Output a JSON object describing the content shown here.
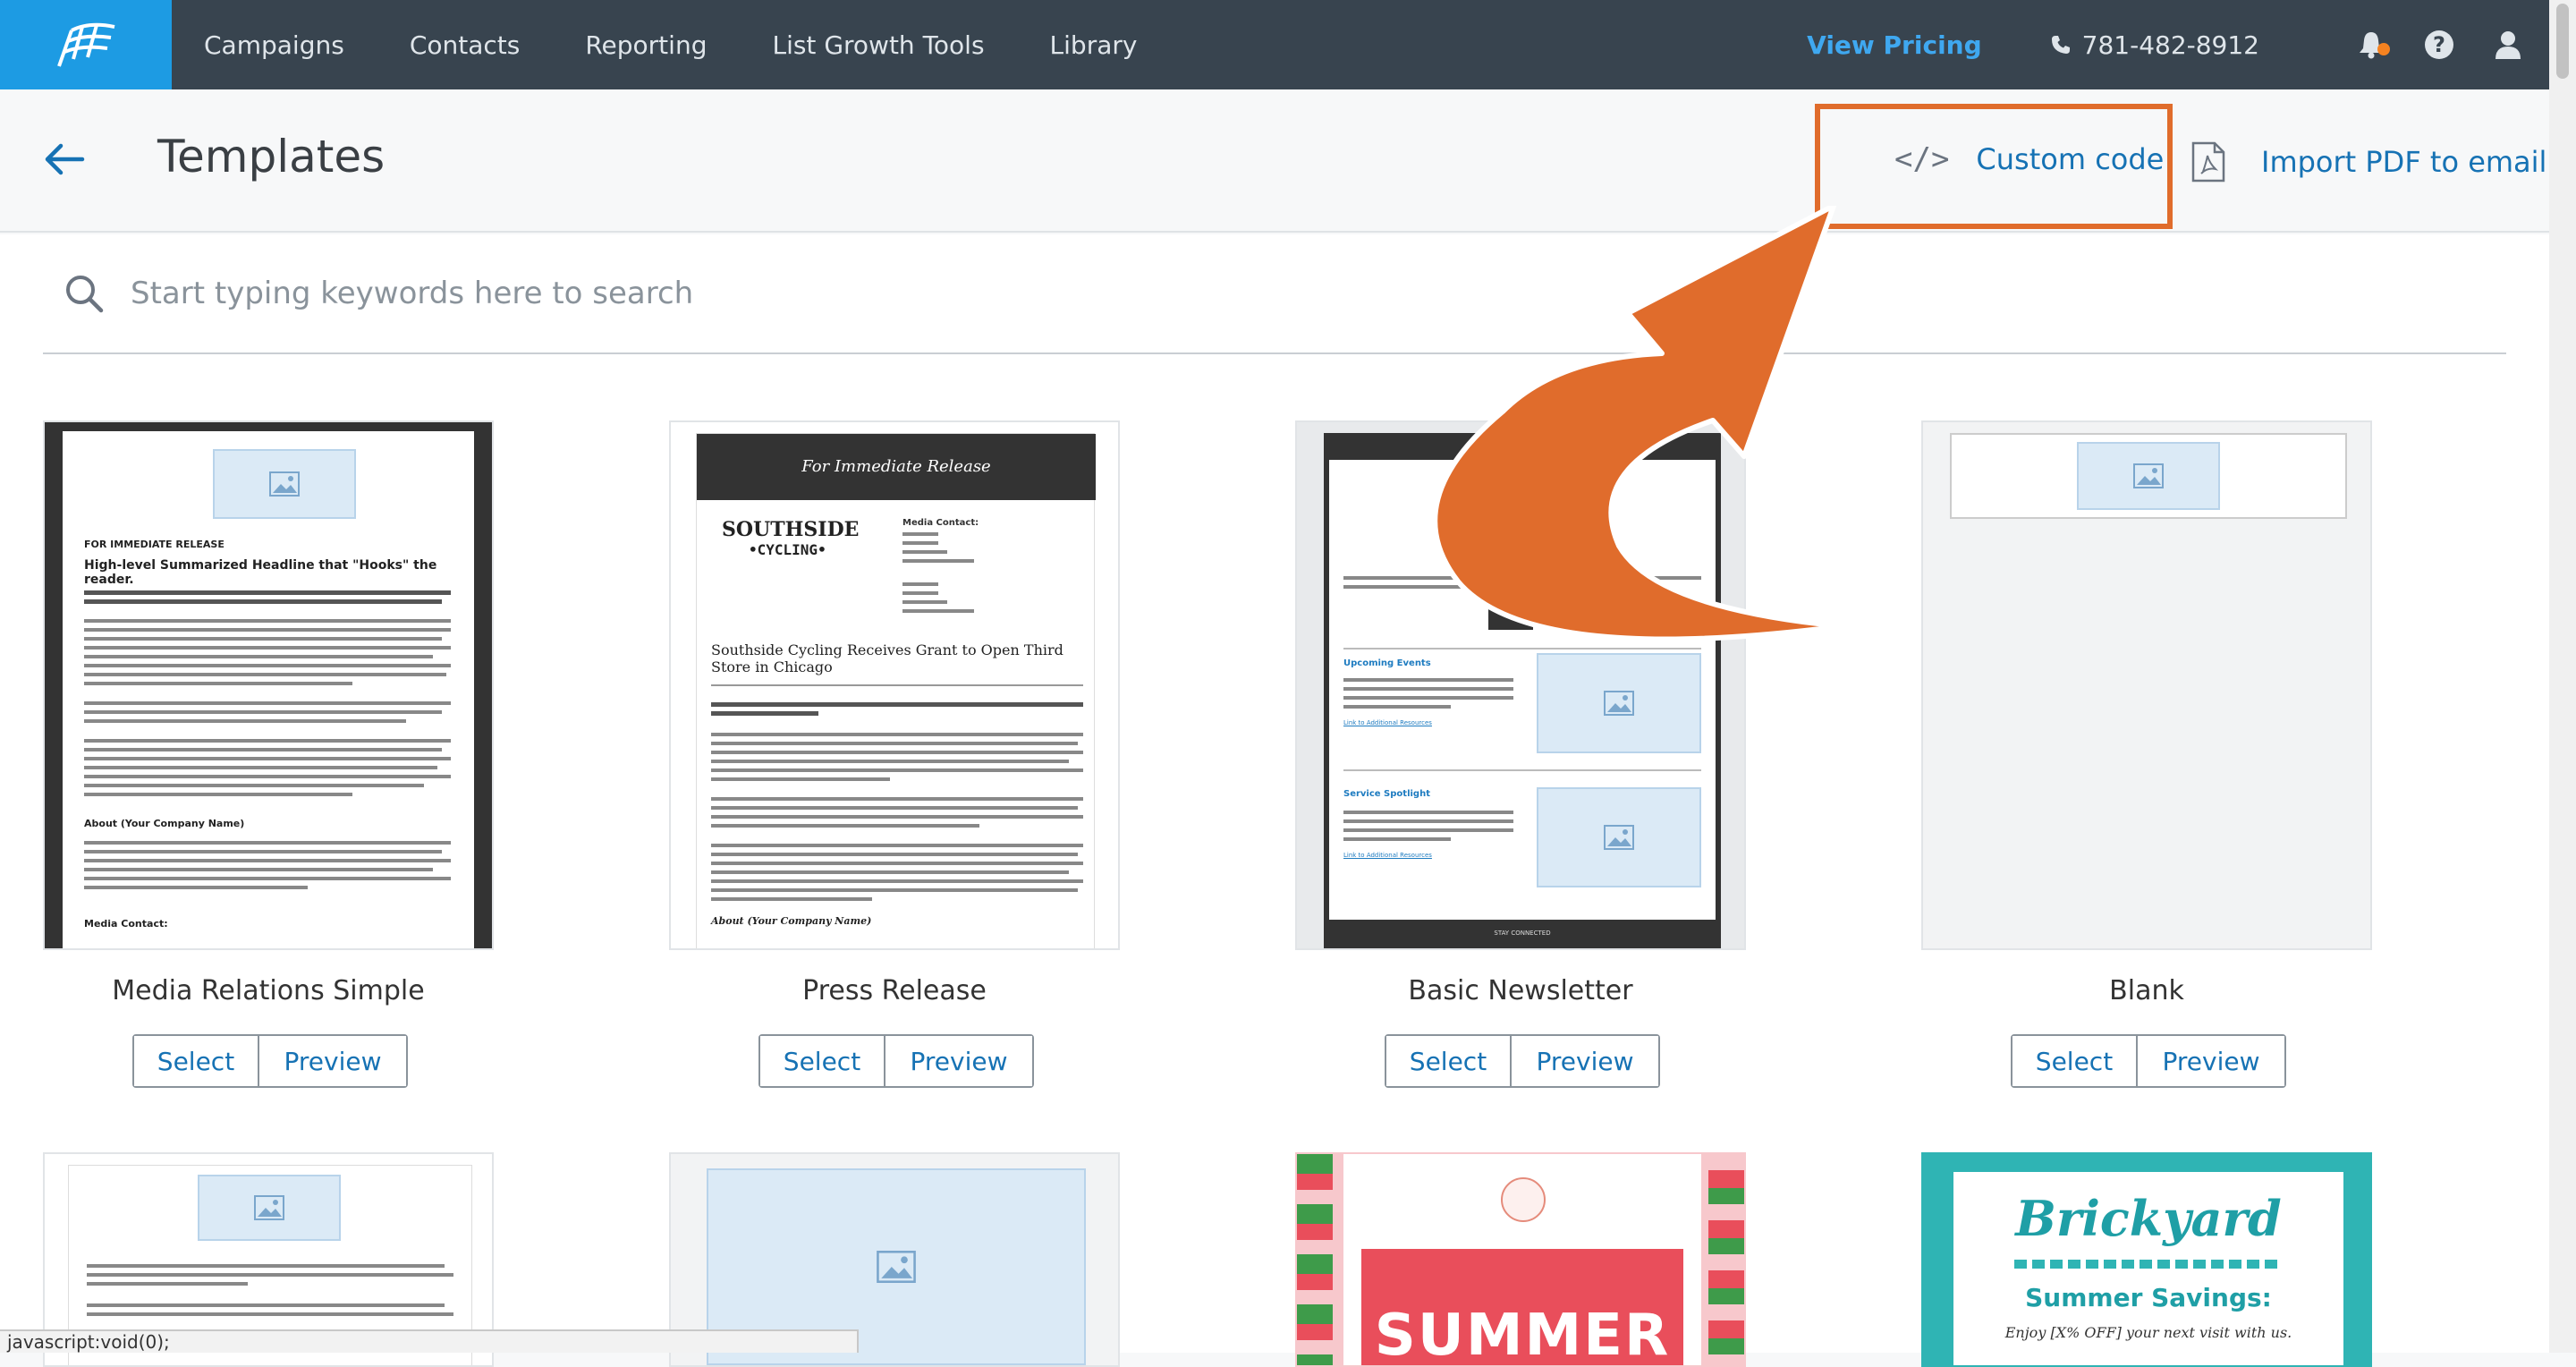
{
  "nav": {
    "items": [
      "Campaigns",
      "Contacts",
      "Reporting",
      "List Growth Tools",
      "Library"
    ],
    "view_pricing": "View Pricing",
    "phone": "781-482-8912"
  },
  "header": {
    "title": "Templates",
    "custom_code": "Custom code",
    "import_pdf": "Import PDF to email"
  },
  "search": {
    "placeholder": "Start typing keywords here to search"
  },
  "templates": [
    {
      "name": "Media Relations Simple",
      "select": "Select",
      "preview": "Preview"
    },
    {
      "name": "Press Release",
      "select": "Select",
      "preview": "Preview"
    },
    {
      "name": "Basic Newsletter",
      "select": "Select",
      "preview": "Preview"
    },
    {
      "name": "Blank",
      "select": "Select",
      "preview": "Preview"
    }
  ],
  "thumb_text": {
    "media_release": "FOR IMMEDIATE RELEASE",
    "media_headline": "High-level Summarized Headline that \"Hooks\" the reader.",
    "media_about": "About (Your Company Name)",
    "media_contact": "Media Contact:",
    "press_banner": "For Immediate Release",
    "press_brand_1": "SOUTHSIDE",
    "press_brand_2": "•CYCLING•",
    "press_contact": "Media Contact:",
    "press_headline": "Southside Cycling Receives Grant to Open Third Store in Chicago",
    "press_about": "About (Your Company Name)",
    "news_upcoming": "Upcoming Events",
    "news_spotlight": "Service Spotlight",
    "news_link": "Link to Additional Resources",
    "news_footer": "STAY CONNECTED",
    "summer_word": "SUMMER",
    "brickyard_logo": "Brickyard",
    "brickyard_title": "Summer Savings:",
    "brickyard_sub": "Enjoy [X% OFF] your next visit with us."
  },
  "statusbar": "javascript:void(0);",
  "colors": {
    "nav_bg": "#38444f",
    "logo_bg": "#1d9be3",
    "link": "#1672b4",
    "highlight": "#e06c2c"
  }
}
